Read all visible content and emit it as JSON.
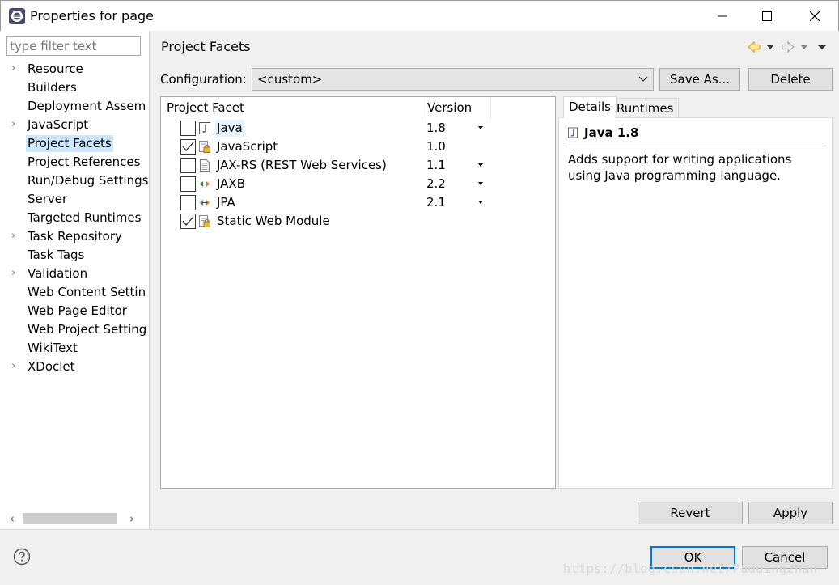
{
  "window": {
    "title": "Properties for page"
  },
  "filter": {
    "placeholder": "type filter text"
  },
  "sidebar": {
    "items": [
      {
        "label": "Resource",
        "expandable": true
      },
      {
        "label": "Builders",
        "expandable": false
      },
      {
        "label": "Deployment Assem",
        "expandable": false
      },
      {
        "label": "JavaScript",
        "expandable": true
      },
      {
        "label": "Project Facets",
        "expandable": false,
        "selected": true
      },
      {
        "label": "Project References",
        "expandable": false
      },
      {
        "label": "Run/Debug Settings",
        "expandable": false
      },
      {
        "label": "Server",
        "expandable": false
      },
      {
        "label": "Targeted Runtimes",
        "expandable": false
      },
      {
        "label": "Task Repository",
        "expandable": true
      },
      {
        "label": "Task Tags",
        "expandable": false
      },
      {
        "label": "Validation",
        "expandable": true
      },
      {
        "label": "Web Content Settin",
        "expandable": false
      },
      {
        "label": "Web Page Editor",
        "expandable": false
      },
      {
        "label": "Web Project Setting",
        "expandable": false
      },
      {
        "label": "WikiText",
        "expandable": false
      },
      {
        "label": "XDoclet",
        "expandable": true
      }
    ]
  },
  "page": {
    "title": "Project Facets"
  },
  "configuration": {
    "label": "Configuration:",
    "value": "<custom>",
    "save_as": "Save As...",
    "delete": "Delete"
  },
  "facets": {
    "col_facet": "Project Facet",
    "col_version": "Version",
    "rows": [
      {
        "name": "Java",
        "version": "1.8",
        "checked": false,
        "has_dropdown": true,
        "icon": "java-icon",
        "selected": true
      },
      {
        "name": "JavaScript",
        "version": "1.0",
        "checked": true,
        "has_dropdown": false,
        "icon": "locked-facet-icon"
      },
      {
        "name": "JAX-RS (REST Web Services)",
        "version": "1.1",
        "checked": false,
        "has_dropdown": true,
        "icon": "document-icon"
      },
      {
        "name": "JAXB",
        "version": "2.2",
        "checked": false,
        "has_dropdown": true,
        "icon": "arrows-icon"
      },
      {
        "name": "JPA",
        "version": "2.1",
        "checked": false,
        "has_dropdown": true,
        "icon": "arrows-icon"
      },
      {
        "name": "Static Web Module",
        "version": "",
        "checked": true,
        "has_dropdown": false,
        "icon": "locked-facet-icon"
      }
    ]
  },
  "details": {
    "tabs": [
      "Details",
      "Runtimes"
    ],
    "active_tab": "Details",
    "title": "Java 1.8",
    "description": "Adds support for writing applications using Java programming language."
  },
  "buttons": {
    "revert": "Revert",
    "apply": "Apply",
    "ok": "OK",
    "cancel": "Cancel"
  },
  "watermark": "https://blog.csdn.net/Puddingzhan",
  "colors": {
    "selection": "#cce8ff",
    "default_button_border": "#0078d7",
    "nav_arrow": "#e8a317"
  }
}
